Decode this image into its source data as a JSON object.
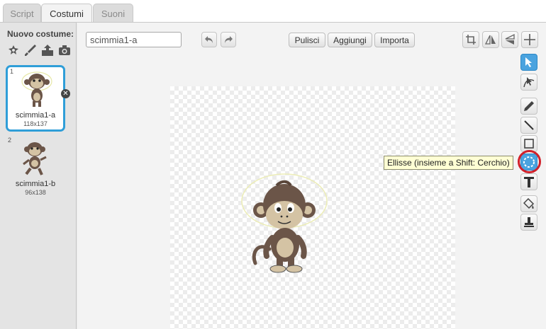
{
  "tabs": [
    {
      "label": "Script",
      "active": false
    },
    {
      "label": "Costumi",
      "active": true
    },
    {
      "label": "Suoni",
      "active": false
    }
  ],
  "new_costume": {
    "label": "Nuovo costume:",
    "icons": [
      "library-sprite-icon",
      "paint-brush-icon",
      "upload-icon",
      "camera-icon"
    ]
  },
  "costumes": [
    {
      "number": "1",
      "name": "scimmia1-a",
      "size": "118x137",
      "selected": true
    },
    {
      "number": "2",
      "name": "scimmia1-b",
      "size": "96x138",
      "selected": false
    }
  ],
  "editor": {
    "costume_name": "scimmia1-a",
    "buttons": {
      "clear": "Pulisci",
      "add": "Aggiungi",
      "import": "Importa"
    }
  },
  "tooltip": "Ellisse (insieme a Shift: Cerchio)",
  "tools": [
    "select-icon",
    "reshape-icon",
    "pencil-icon",
    "line-icon",
    "rectangle-icon",
    "ellipse-icon",
    "text-icon",
    "fill-icon",
    "stamp-icon"
  ],
  "colors": {
    "selection_blue": "#2f9ed8",
    "highlight_red": "#d0202a",
    "tooltip_bg": "#ffffd4"
  }
}
